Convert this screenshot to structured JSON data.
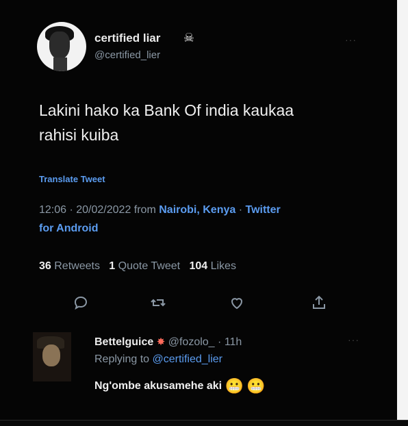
{
  "tweet": {
    "display_name": "certified liar",
    "name_icon": "skull-crossbones-icon",
    "handle": "@certified_lier",
    "more": "···",
    "text_line1": "Lakini hako ka Bank Of india kaukaa",
    "text_line2": "rahisi kuiba",
    "translate_label": "Translate Tweet",
    "time_date": "12:06 · 20/02/2022 from ",
    "location": "Nairobi, Kenya",
    "separator": " · ",
    "client_part1": "Twitter",
    "client_part2": "for Android",
    "stats": {
      "retweets_count": "36",
      "retweets_label": "Retweets",
      "quotes_count": "1",
      "quotes_label": "Quote Tweet",
      "likes_count": "104",
      "likes_label": "Likes"
    },
    "actions": [
      {
        "name": "reply",
        "icon": "reply-icon"
      },
      {
        "name": "retweet",
        "icon": "retweet-icon"
      },
      {
        "name": "like",
        "icon": "heart-icon"
      },
      {
        "name": "share",
        "icon": "share-icon"
      }
    ]
  },
  "reply": {
    "display_name": "Bettelguice",
    "badge_icon": "burst-icon",
    "handle": "@fozolo_",
    "separator": "·",
    "time": "11h",
    "more": "···",
    "replying_label": "Replying to ",
    "replying_handle": "@certified_lier",
    "text": "Ng'ombe akusamehe aki",
    "emoji_icons": [
      "grimacing-face-icon",
      "grimacing-face-icon"
    ]
  },
  "colors": {
    "background": "#000000",
    "text": "#f0f0f0",
    "muted": "#8b98a5",
    "link": "#5b9cf0"
  }
}
